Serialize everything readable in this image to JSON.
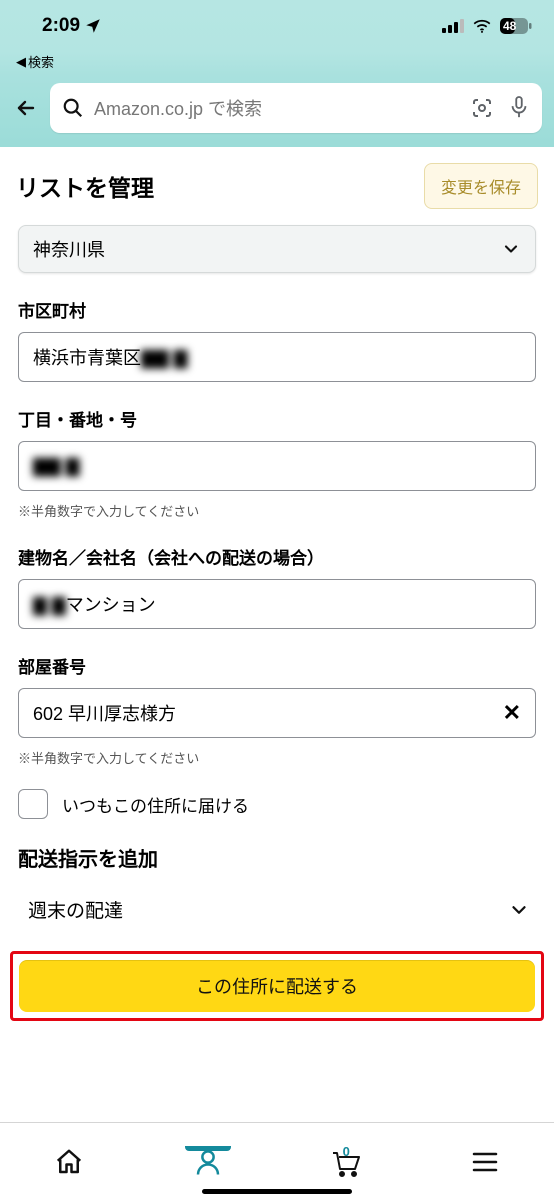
{
  "status": {
    "time": "2:09",
    "back_link": "検索",
    "battery": "48"
  },
  "search": {
    "placeholder": "Amazon.co.jp で検索"
  },
  "title_bar": {
    "title": "リストを管理",
    "save_label": "変更を保存"
  },
  "form": {
    "prefecture": {
      "value": "神奈川県"
    },
    "city": {
      "label": "市区町村",
      "value_visible": "横浜市青葉区",
      "value_blurred": "▇▇ ▇"
    },
    "street": {
      "label": "丁目・番地・号",
      "value_blurred": "▇▇ ▇",
      "hint": "※半角数字で入力してください"
    },
    "building": {
      "label": "建物名／会社名（会社への配送の場合）",
      "value_blurred": "▇ ▇",
      "value_visible": "マンション"
    },
    "room": {
      "label": "部屋番号",
      "value": "602 早川厚志様方",
      "hint": "※半角数字で入力してください"
    },
    "default_checkbox_label": "いつもこの住所に届ける",
    "delivery_section": "配送指示を追加",
    "weekend_label": "週末の配達",
    "submit_label": "この住所に配送する"
  },
  "nav": {
    "cart_count": "0"
  }
}
